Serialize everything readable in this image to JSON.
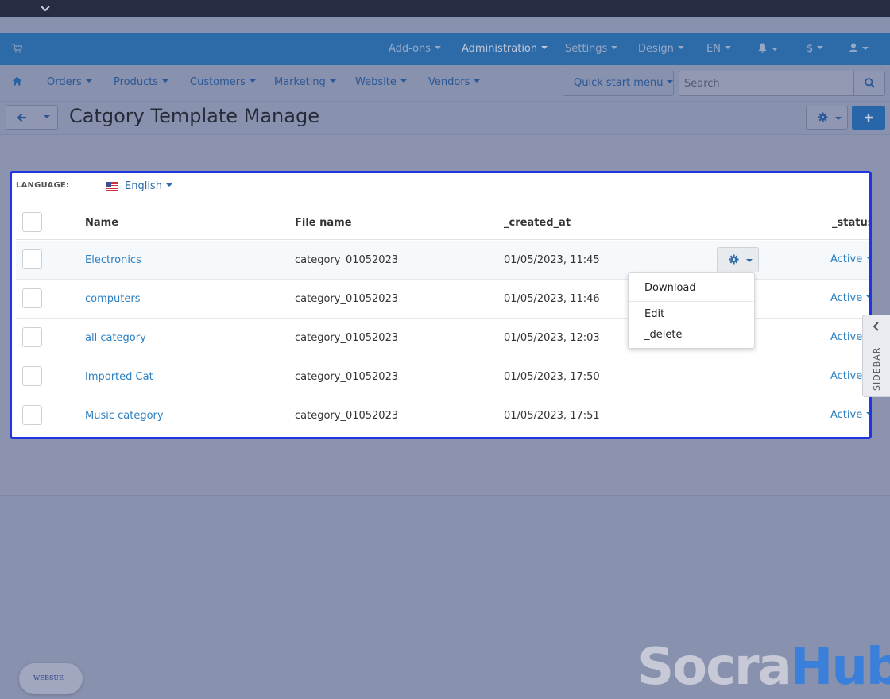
{
  "topnav": {
    "items": [
      "Add-ons",
      "Administration",
      "Settings",
      "Design",
      "EN",
      "$"
    ]
  },
  "mainmenu": {
    "items": [
      "Orders",
      "Products",
      "Customers",
      "Marketing",
      "Website",
      "Vendors"
    ],
    "quick_start": "Quick start menu",
    "search_placeholder": "Search"
  },
  "page": {
    "title": "Catgory Template Manage"
  },
  "language": {
    "label": "LANGUAGE:",
    "value": "English"
  },
  "table": {
    "headers": [
      "Name",
      "File name",
      "_created_at",
      "_status"
    ],
    "rows": [
      {
        "name": "Electronics",
        "file": "category_01052023",
        "created": "01/05/2023, 11:45",
        "status": "Active"
      },
      {
        "name": "computers",
        "file": "category_01052023",
        "created": "01/05/2023, 11:46",
        "status": "Active"
      },
      {
        "name": "all category",
        "file": "category_01052023",
        "created": "01/05/2023, 12:03",
        "status": "Active"
      },
      {
        "name": "Imported Cat",
        "file": "category_01052023",
        "created": "01/05/2023, 17:50",
        "status": "Active"
      },
      {
        "name": "Music category",
        "file": "category_01052023",
        "created": "01/05/2023, 17:51",
        "status": "Active"
      }
    ]
  },
  "row_menu": {
    "items": [
      "Download",
      "Edit",
      "_delete"
    ]
  },
  "sidebar": {
    "label": "SIDEBAR"
  },
  "badge": {
    "text": "WEBSUE"
  },
  "watermark": {
    "part1": "Socra",
    "part2": "Hub"
  },
  "colors": {
    "accent": "#2c6ba8",
    "highlight_border": "#1f35e0",
    "link": "#2c7fc0"
  },
  "icons": [
    "chevron-down-icon",
    "cart-icon",
    "home-icon",
    "bell-icon",
    "user-icon",
    "search-icon",
    "arrow-left-icon",
    "gear-icon",
    "plus-icon",
    "us-flag-icon",
    "chevron-left-icon"
  ]
}
